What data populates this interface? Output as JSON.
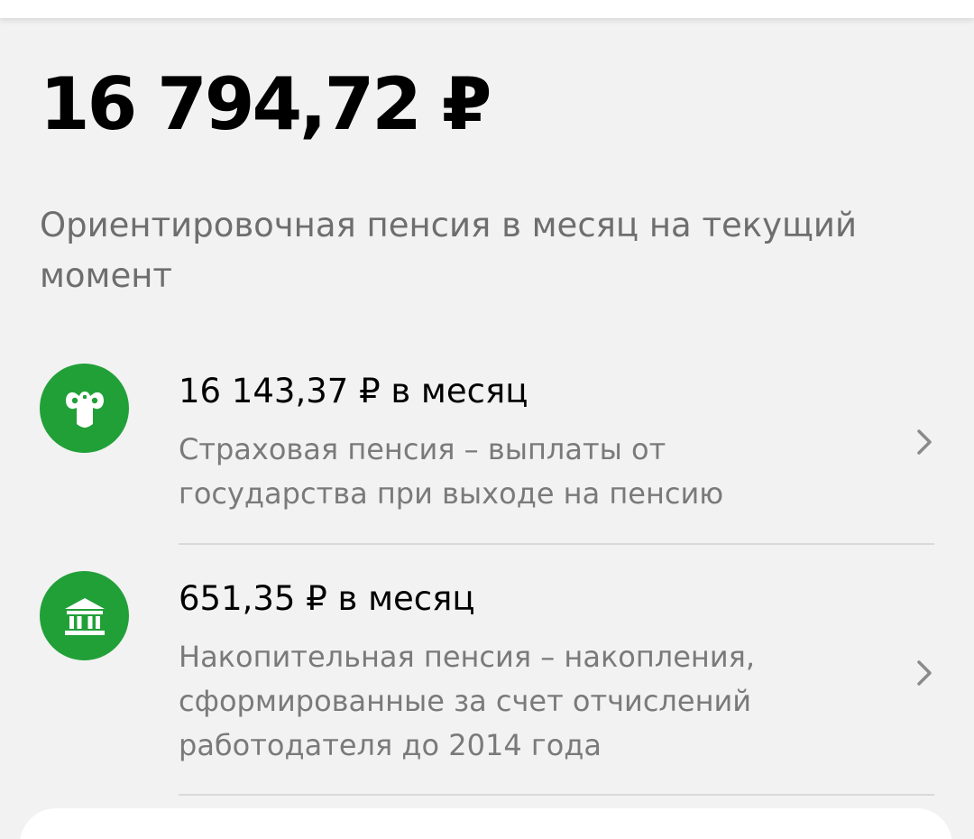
{
  "summary": {
    "total_amount": "16 794,72 ₽",
    "subtitle": "Ориентировочная пенсия в месяц на текущий момент"
  },
  "pension_items": [
    {
      "amount": "16 143,37 ₽ в месяц",
      "description": "Страховая пенсия – выплаты от государства при выходе на пенсию",
      "icon": "sfr-emblem-icon"
    },
    {
      "amount": "651,35 ₽ в месяц",
      "description": "Накопительная пенсия – накопления, сформированные за счет отчислений работодателя до 2014 года",
      "icon": "bank-building-icon"
    }
  ],
  "colors": {
    "accent_green": "#21a038",
    "background": "#f2f2f2",
    "secondary_text": "#7a7a7a"
  }
}
